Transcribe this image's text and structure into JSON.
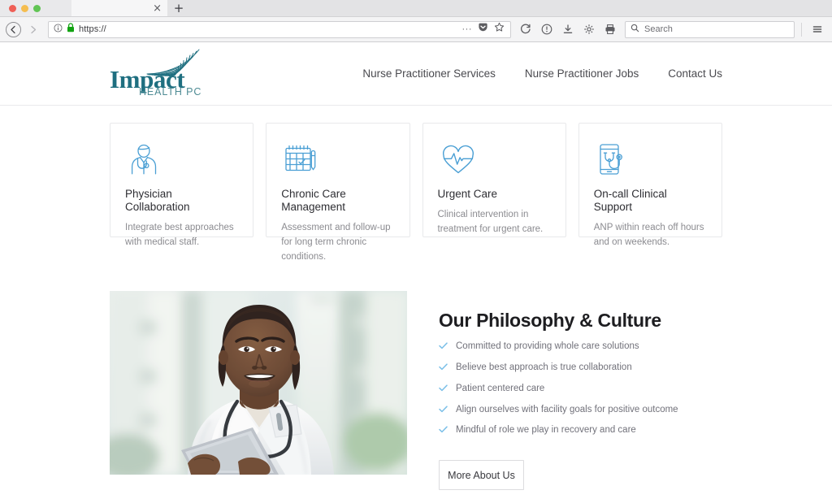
{
  "browser": {
    "tab": {
      "title": "",
      "close_label": "×"
    },
    "new_tab_label": "+",
    "back_label": "←",
    "forward_label": "→",
    "url_value": "https://",
    "search_placeholder": "Search",
    "icons": {
      "site_info": "info-circle-icon",
      "lock": "padlock-icon",
      "more": "···",
      "pocket": "pocket-icon",
      "bookmark": "star-icon",
      "reload": "reload-icon",
      "page_info": "info-icon",
      "downloads": "download-icon",
      "settings": "gear-icon",
      "print": "printer-icon",
      "menu": "hamburger-menu-icon"
    }
  },
  "site": {
    "logo": {
      "word": "Impact",
      "sub": "HEALTH PC",
      "color": "#1f6f80"
    },
    "nav": [
      {
        "label": "Nurse Practitioner Services"
      },
      {
        "label": "Nurse Practitioner Jobs"
      },
      {
        "label": "Contact Us"
      }
    ],
    "cards": [
      {
        "icon": "doctor-icon",
        "title": "Physician Collaboration",
        "desc": "Integrate best approaches with medical staff."
      },
      {
        "icon": "calendar-check-icon",
        "title": "Chronic Care Management",
        "desc": "Assessment and follow-up for long term chronic conditions."
      },
      {
        "icon": "heart-pulse-icon",
        "title": "Urgent Care",
        "desc": "Clinical intervention in treatment for urgent care."
      },
      {
        "icon": "phone-stethoscope-icon",
        "title": "On-call Clinical Support",
        "desc": "ANP within reach off hours and on weekends."
      }
    ],
    "philosophy": {
      "photo_alt": "Smiling doctor in white coat with stethoscope holding a tablet",
      "title": "Our Philosophy & Culture",
      "checklist": [
        "Committed to providing whole care solutions",
        "Believe best approach is true collaboration",
        "Patient centered care",
        "Align ourselves with facility goals for positive outcome",
        "Mindful of role we play in recovery and care"
      ],
      "button_label": "More About Us"
    },
    "colors": {
      "brand_teal": "#1f6f80",
      "icon_blue": "#4a9fd4",
      "check_blue": "#7cc0e8",
      "body_gray": "#8b8b90"
    }
  }
}
